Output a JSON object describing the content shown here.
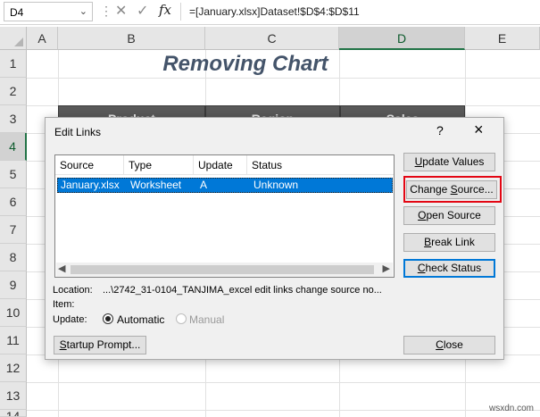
{
  "formula_bar": {
    "name_box": "D4",
    "formula": "=[January.xlsx]Dataset!$D$4:$D$11"
  },
  "grid": {
    "columns": [
      "A",
      "B",
      "C",
      "D",
      "E"
    ],
    "active_column": "D",
    "rows": [
      "1",
      "2",
      "3",
      "4",
      "5",
      "6",
      "7",
      "8",
      "9",
      "10",
      "11",
      "12",
      "13",
      "14"
    ],
    "active_row": "4"
  },
  "sheet": {
    "title": "Removing Chart",
    "table_headers": [
      "Product",
      "Region",
      "Sales"
    ]
  },
  "dialog": {
    "title": "Edit Links",
    "help": "?",
    "close": "×",
    "list": {
      "headers": [
        "Source",
        "Type",
        "Update",
        "Status"
      ],
      "rows": [
        {
          "source": "January.xlsx",
          "type": "Worksheet",
          "update": "A",
          "status": "Unknown"
        }
      ]
    },
    "buttons": {
      "update_values": {
        "pre": "",
        "key": "U",
        "post": "pdate Values"
      },
      "change_source": {
        "pre": "Change ",
        "key": "S",
        "post": "ource..."
      },
      "open_source": {
        "pre": "",
        "key": "O",
        "post": "pen Source"
      },
      "break_link": {
        "pre": "",
        "key": "B",
        "post": "reak Link"
      },
      "check_status": {
        "pre": "",
        "key": "C",
        "post": "heck Status"
      },
      "startup_prompt": {
        "pre": "",
        "key": "S",
        "post": "tartup Prompt..."
      },
      "close": {
        "pre": "",
        "key": "C",
        "post": "lose"
      }
    },
    "location_label": "Location:",
    "location_value": "...\\2742_31-0104_TANJIMA_excel edit links change source no...",
    "item_label": "Item:",
    "update_label": "Update:",
    "update_options": [
      {
        "label": "Automatic",
        "selected": true,
        "enabled": true
      },
      {
        "label": "Manual",
        "selected": false,
        "enabled": false
      }
    ]
  },
  "watermark": "wsxdn.com",
  "icons": {
    "dropdown": "chevron-down-icon",
    "cancel": "cancel-x-icon",
    "enter": "checkmark-icon",
    "function": "fx-icon",
    "scroll_left": "scroll-left-icon",
    "scroll_right": "scroll-right-icon"
  },
  "colors": {
    "title_text": "#44546a",
    "selection": "#0078d7",
    "highlight_box": "#e30613",
    "excel_green": "#217346"
  }
}
